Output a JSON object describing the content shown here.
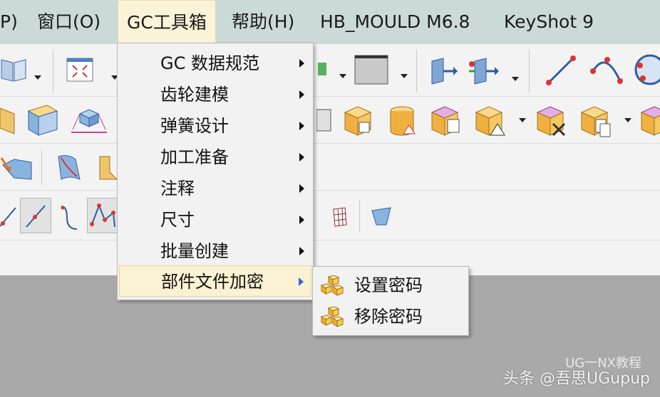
{
  "menubar": {
    "items": [
      {
        "label": "P)"
      },
      {
        "label": "窗口(O)"
      },
      {
        "label": "GC工具箱"
      },
      {
        "label": "帮助(H)"
      },
      {
        "label": "HB_MOULD M6.8"
      },
      {
        "label": "KeyShot 9"
      }
    ]
  },
  "gc_menu": {
    "items": [
      {
        "label": "GC 数据规范"
      },
      {
        "label": "齿轮建模"
      },
      {
        "label": "弹簧设计"
      },
      {
        "label": "加工准备"
      },
      {
        "label": "注释"
      },
      {
        "label": "尺寸"
      },
      {
        "label": "批量创建"
      },
      {
        "label": "部件文件加密"
      }
    ]
  },
  "encrypt_submenu": {
    "items": [
      {
        "label": "设置密码",
        "icon": "yellow-cubes-icon"
      },
      {
        "label": "移除密码",
        "icon": "yellow-cubes-icon"
      }
    ]
  },
  "watermark": {
    "text": "头条 @吾思UGupup",
    "handle": "UG一NX教程"
  },
  "colors": {
    "menubar_bg": "#ccd9d9",
    "menu_bg": "#f2f2f2",
    "highlight": "#fbf1d3",
    "workspace": "#a9a9a9"
  }
}
